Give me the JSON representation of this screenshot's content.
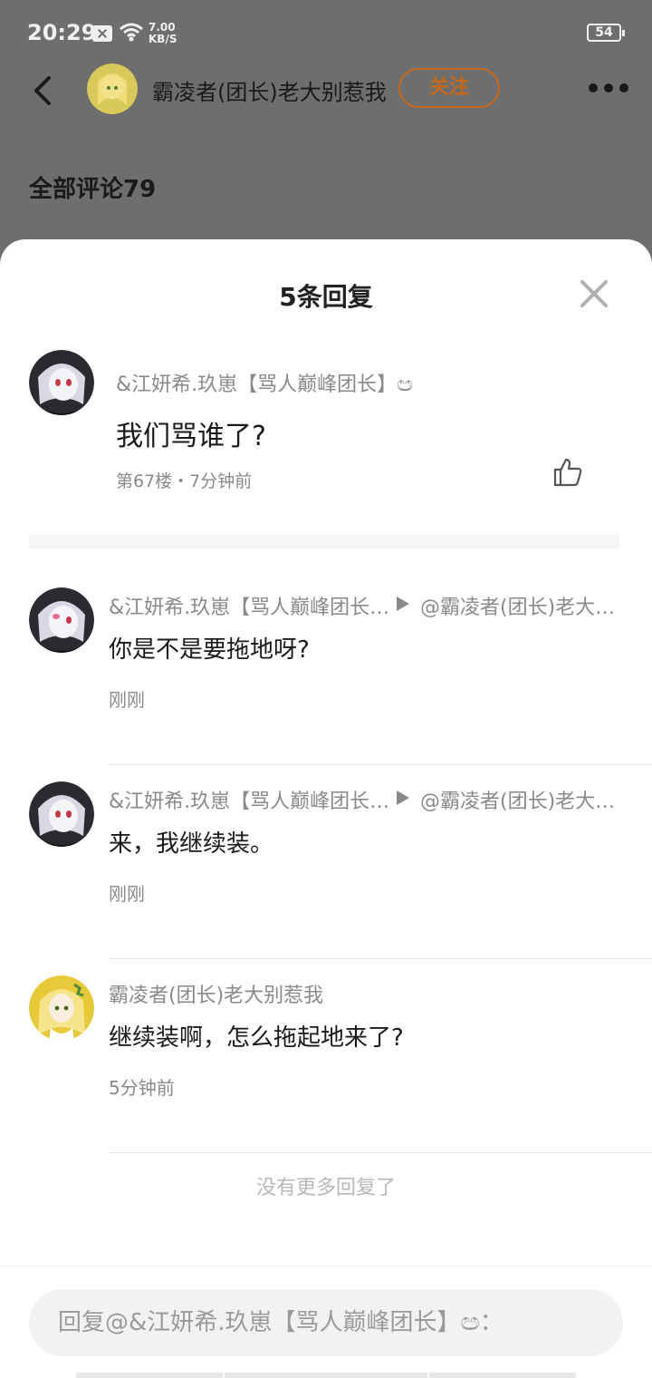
{
  "status_bar": {
    "time": "20:29",
    "speed_value": "7.00",
    "speed_unit": "KB/S",
    "battery": "54"
  },
  "header": {
    "username": "霸凌者(团长)老大别惹我",
    "follow_label": "关注"
  },
  "background": {
    "all_comments_label": "全部评论79"
  },
  "sheet": {
    "title": "5条回复",
    "main_comment": {
      "author": "&江妍希.玖崽【骂人巅峰团长】ඏ",
      "text": "我们骂谁了?",
      "meta": "第67楼・7分钟前"
    },
    "replies": [
      {
        "author": "&江妍希.玖崽【骂人巅峰团长】ඏ",
        "target": "@霸凌者(团长)老大别惹我",
        "text": "你是不是要拖地呀?",
        "time": "刚刚",
        "avatar": "dark"
      },
      {
        "author": "&江妍希.玖崽【骂人巅峰团长】ඏ",
        "target": "@霸凌者(团长)老大别惹我",
        "text": "来，我继续装。",
        "time": "刚刚",
        "avatar": "dark"
      },
      {
        "author": "霸凌者(团长)老大别惹我",
        "target": "",
        "text": "继续装啊，怎么拖起地来了?",
        "time": "5分钟前",
        "avatar": "yellow"
      }
    ],
    "no_more": "没有更多回复了",
    "input_placeholder": "回复@&江妍希.玖崽【骂人巅峰团长】ඏ："
  },
  "colors": {
    "accent": "#c4691c",
    "overlay": "#6e6e6e",
    "muted_text": "#8a8a8a"
  }
}
